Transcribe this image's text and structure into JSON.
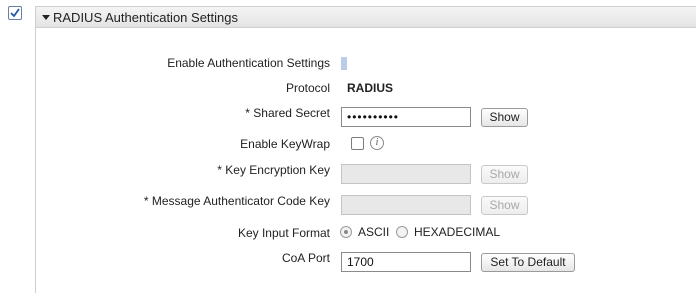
{
  "section": {
    "title": "RADIUS Authentication Settings",
    "enabled": true
  },
  "form": {
    "enable_auth_label": "Enable Authentication Settings",
    "protocol_label": "Protocol",
    "protocol_value": "RADIUS",
    "shared_secret_label": "* Shared Secret",
    "shared_secret_value": "••••••••••",
    "shared_secret_show": "Show",
    "enable_keywrap_label": "Enable KeyWrap",
    "key_encryption_label": "*  Key Encryption Key",
    "key_encryption_value": "",
    "key_encryption_show": "Show",
    "mac_key_label": "*  Message Authenticator Code Key",
    "mac_key_value": "",
    "mac_key_show": "Show",
    "key_input_format_label": "Key Input Format",
    "format_options": [
      "ASCII",
      "HEXADECIMAL"
    ],
    "format_selected": "ASCII",
    "coa_port_label": "CoA Port",
    "coa_port_value": "1700",
    "set_default_label": "Set To Default"
  },
  "icons": {
    "section_toggle": "triangle-down-icon",
    "info": "info-icon"
  }
}
